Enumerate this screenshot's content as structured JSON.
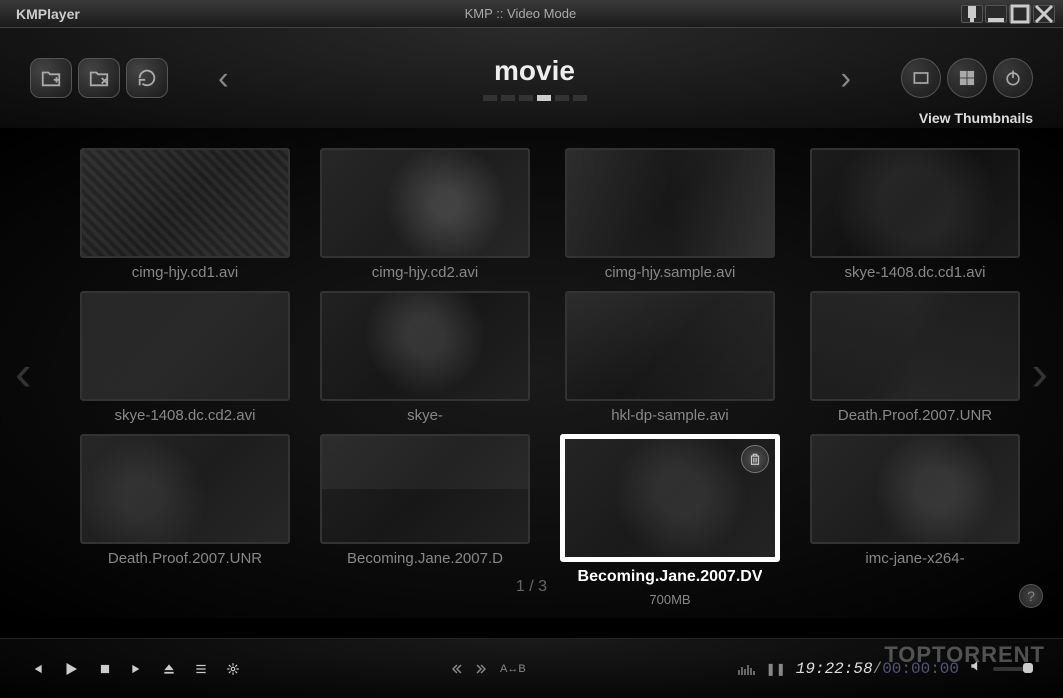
{
  "titlebar": {
    "app_name": "KMPlayer",
    "window_title": "KMP :: Video Mode"
  },
  "toolbar": {
    "category": "movie",
    "view_label": "View Thumbnails",
    "dots_total": 6,
    "dots_active": 3
  },
  "thumbnails": [
    {
      "label": "cimg-hjy.cd1.avi",
      "selected": false
    },
    {
      "label": "cimg-hjy.cd2.avi",
      "selected": false
    },
    {
      "label": "cimg-hjy.sample.avi",
      "selected": false
    },
    {
      "label": "skye-1408.dc.cd1.avi",
      "selected": false
    },
    {
      "label": "skye-1408.dc.cd2.avi",
      "selected": false
    },
    {
      "label": "skye-",
      "selected": false
    },
    {
      "label": "hkl-dp-sample.avi",
      "selected": false
    },
    {
      "label": "Death.Proof.2007.UNR",
      "selected": false
    },
    {
      "label": "Death.Proof.2007.UNR",
      "selected": false
    },
    {
      "label": "Becoming.Jane.2007.D",
      "selected": false
    },
    {
      "label": "Becoming.Jane.2007.DV",
      "selected": true,
      "size": "700MB"
    },
    {
      "label": "imc-jane-x264-",
      "selected": false
    }
  ],
  "pagination": {
    "current": "1",
    "sep": " / ",
    "total": "3"
  },
  "controls": {
    "ab_label": "A↔B",
    "time_current": "19:22:58",
    "time_sep": "/",
    "time_total": "00:00:00"
  },
  "help": "?",
  "watermark": "TOPTORRENT"
}
